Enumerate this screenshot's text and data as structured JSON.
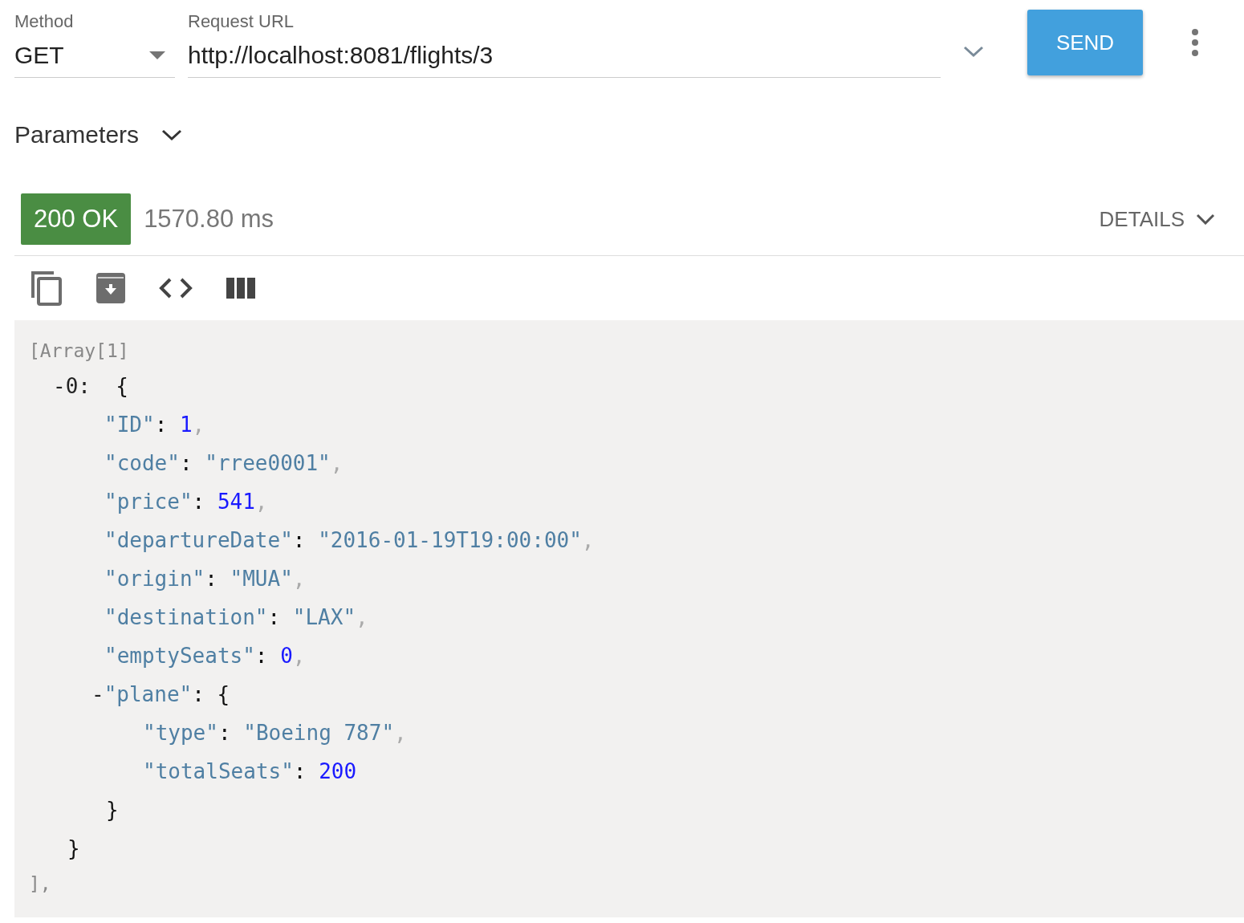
{
  "request": {
    "method_label": "Method",
    "method": "GET",
    "url_label": "Request URL",
    "url": "http://localhost:8081/flights/3",
    "send": "SEND"
  },
  "parameters": {
    "label": "Parameters",
    "expanded": false
  },
  "status": {
    "code": "200 OK",
    "color": "#4a8d43",
    "time": "1570.80 ms",
    "details": "DETAILS"
  },
  "response": {
    "header": "[Array[1]",
    "footer": "],",
    "tree": [
      {
        "parts": [
          {
            "text": "-0:",
            "kind": "toggle"
          },
          {
            "text": "  {",
            "kind": "punct"
          }
        ],
        "close": "}",
        "children": [
          {
            "parts": [
              {
                "text": "\"ID\"",
                "kind": "key"
              },
              {
                "text": ": ",
                "kind": "punct"
              },
              {
                "text": "1",
                "kind": "number"
              },
              {
                "text": ",",
                "kind": "comma"
              }
            ]
          },
          {
            "parts": [
              {
                "text": "\"code\"",
                "kind": "key"
              },
              {
                "text": ": ",
                "kind": "punct"
              },
              {
                "text": "\"rree0001\"",
                "kind": "string"
              },
              {
                "text": ",",
                "kind": "comma"
              }
            ]
          },
          {
            "parts": [
              {
                "text": "\"price\"",
                "kind": "key"
              },
              {
                "text": ": ",
                "kind": "punct"
              },
              {
                "text": "541",
                "kind": "number"
              },
              {
                "text": ",",
                "kind": "comma"
              }
            ]
          },
          {
            "parts": [
              {
                "text": "\"departureDate\"",
                "kind": "key"
              },
              {
                "text": ": ",
                "kind": "punct"
              },
              {
                "text": "\"2016-01-19T19:00:00\"",
                "kind": "string"
              },
              {
                "text": ",",
                "kind": "comma"
              }
            ]
          },
          {
            "parts": [
              {
                "text": "\"origin\"",
                "kind": "key"
              },
              {
                "text": ": ",
                "kind": "punct"
              },
              {
                "text": "\"MUA\"",
                "kind": "string"
              },
              {
                "text": ",",
                "kind": "comma"
              }
            ]
          },
          {
            "parts": [
              {
                "text": "\"destination\"",
                "kind": "key"
              },
              {
                "text": ": ",
                "kind": "punct"
              },
              {
                "text": "\"LAX\"",
                "kind": "string"
              },
              {
                "text": ",",
                "kind": "comma"
              }
            ]
          },
          {
            "parts": [
              {
                "text": "\"emptySeats\"",
                "kind": "key"
              },
              {
                "text": ": ",
                "kind": "punct"
              },
              {
                "text": "0",
                "kind": "number"
              },
              {
                "text": ",",
                "kind": "comma"
              }
            ]
          },
          {
            "parts": [
              {
                "text": "-",
                "kind": "toggle"
              },
              {
                "text": "\"plane\"",
                "kind": "key"
              },
              {
                "text": ": {",
                "kind": "punct"
              }
            ],
            "close": "}",
            "children": [
              {
                "parts": [
                  {
                    "text": "\"type\"",
                    "kind": "key"
                  },
                  {
                    "text": ": ",
                    "kind": "punct"
                  },
                  {
                    "text": "\"Boeing 787\"",
                    "kind": "string"
                  },
                  {
                    "text": ",",
                    "kind": "comma"
                  }
                ]
              },
              {
                "parts": [
                  {
                    "text": "\"totalSeats\"",
                    "kind": "key"
                  },
                  {
                    "text": ": ",
                    "kind": "punct"
                  },
                  {
                    "text": "200",
                    "kind": "number"
                  }
                ]
              }
            ]
          }
        ]
      }
    ]
  }
}
